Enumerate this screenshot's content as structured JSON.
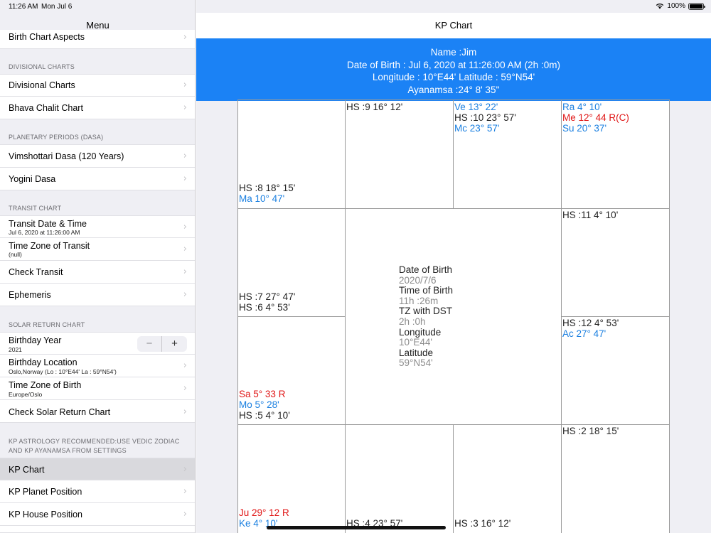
{
  "status_bar": {
    "time": "11:26 AM",
    "date": "Mon Jul 6",
    "battery": "100%",
    "battery_level": 1.0
  },
  "sidebar": {
    "title": "Menu",
    "partial_item": "Birth Chart Aspects",
    "sections": [
      {
        "label": "DIVISIONAL CHARTS"
      },
      {
        "label": "PLANETARY PERIODS (DASA)"
      },
      {
        "label": "TRANSIT CHART"
      },
      {
        "label": "SOLAR RETURN CHART"
      },
      {
        "label_line1": "KP ASTROLOGY RECOMMENDED:USE VEDIC ZODIAC",
        "label_line2": "AND KP AYANAMSA FROM SETTINGS"
      }
    ],
    "items": {
      "divisional_charts": "Divisional Charts",
      "bhava_chalit": "Bhava Chalit Chart",
      "vimshottari": "Vimshottari Dasa (120 Years)",
      "yogini": "Yogini Dasa",
      "transit_datetime": {
        "title": "Transit Date & Time",
        "sub": "Jul 6, 2020 at 11:26:00 AM"
      },
      "transit_tz": {
        "title": "Time Zone of Transit",
        "sub": "(null)"
      },
      "check_transit": "Check Transit",
      "ephemeris": "Ephemeris",
      "birthday_year": {
        "title": "Birthday Year",
        "sub": "2021",
        "minus": "−",
        "plus": "+"
      },
      "birthday_location": {
        "title": "Birthday Location",
        "sub": "Oslo,Norway (Lo : 10°E44'  La : 59°N54')"
      },
      "tz_birth": {
        "title": "Time Zone of Birth",
        "sub": "Europe/Oslo"
      },
      "check_solar": "Check Solar Return Chart",
      "kp_chart": "KP Chart",
      "kp_planet": "KP Planet Position",
      "kp_house": "KP House Position"
    },
    "chevron": "›"
  },
  "main": {
    "title": "KP Chart",
    "banner": {
      "line1": "Name :Jim",
      "line2": "Date of Birth : Jul 6, 2020 at 11:26:00 AM (2h :0m)",
      "line3": "Longitude : 10°E44' Latitude : 59°N54'",
      "line4": "Ayanamsa :24° 8' 35''"
    },
    "chart": {
      "cells": {
        "top_col2": [
          "HS :9 16° 12'"
        ],
        "top_col3": [
          "Ve 13° 22'",
          "HS :10 23° 57'",
          "Mc 23° 57'"
        ],
        "top_col4": [
          "Ra 4° 10'",
          "Me 12° 44 R(C)",
          "Su 20° 37'"
        ],
        "top_col1": [
          "HS :8 18° 15'",
          "Ma 10° 47'"
        ],
        "mid1_left": [
          "HS :7 27° 47'",
          "HS :6 4° 53'"
        ],
        "mid1_right": [
          "HS :11 4° 10'"
        ],
        "mid2_left": [
          "Sa 5° 33 R",
          "Mo 5° 28'",
          "HS :5 4° 10'"
        ],
        "mid2_right": [
          "HS :12 4° 53'",
          "Ac 27° 47'"
        ],
        "bot_col1": [
          "Ju 29° 12 R",
          "Ke 4° 10'"
        ],
        "bot_col2": [
          "HS :4 23° 57'"
        ],
        "bot_col3": [
          "HS :3 16° 12'"
        ],
        "bot_col4": [
          "HS :2 18° 15'"
        ]
      },
      "center": {
        "dob_label": "Date of Birth",
        "dob_value": "2020/7/6",
        "tob_label": "Time of Birth",
        "tob_value": "11h :26m",
        "tz_label": "TZ with DST",
        "tz_value": "2h :0h",
        "lon_label": "Longitude",
        "lon_value": "10°E44'",
        "lat_label": "Latitude",
        "lat_value": "59°N54'"
      }
    }
  },
  "colors": {
    "accent": "#1b82f5",
    "retro_red": "#e01616",
    "planet_blue": "#1a7fe0"
  }
}
